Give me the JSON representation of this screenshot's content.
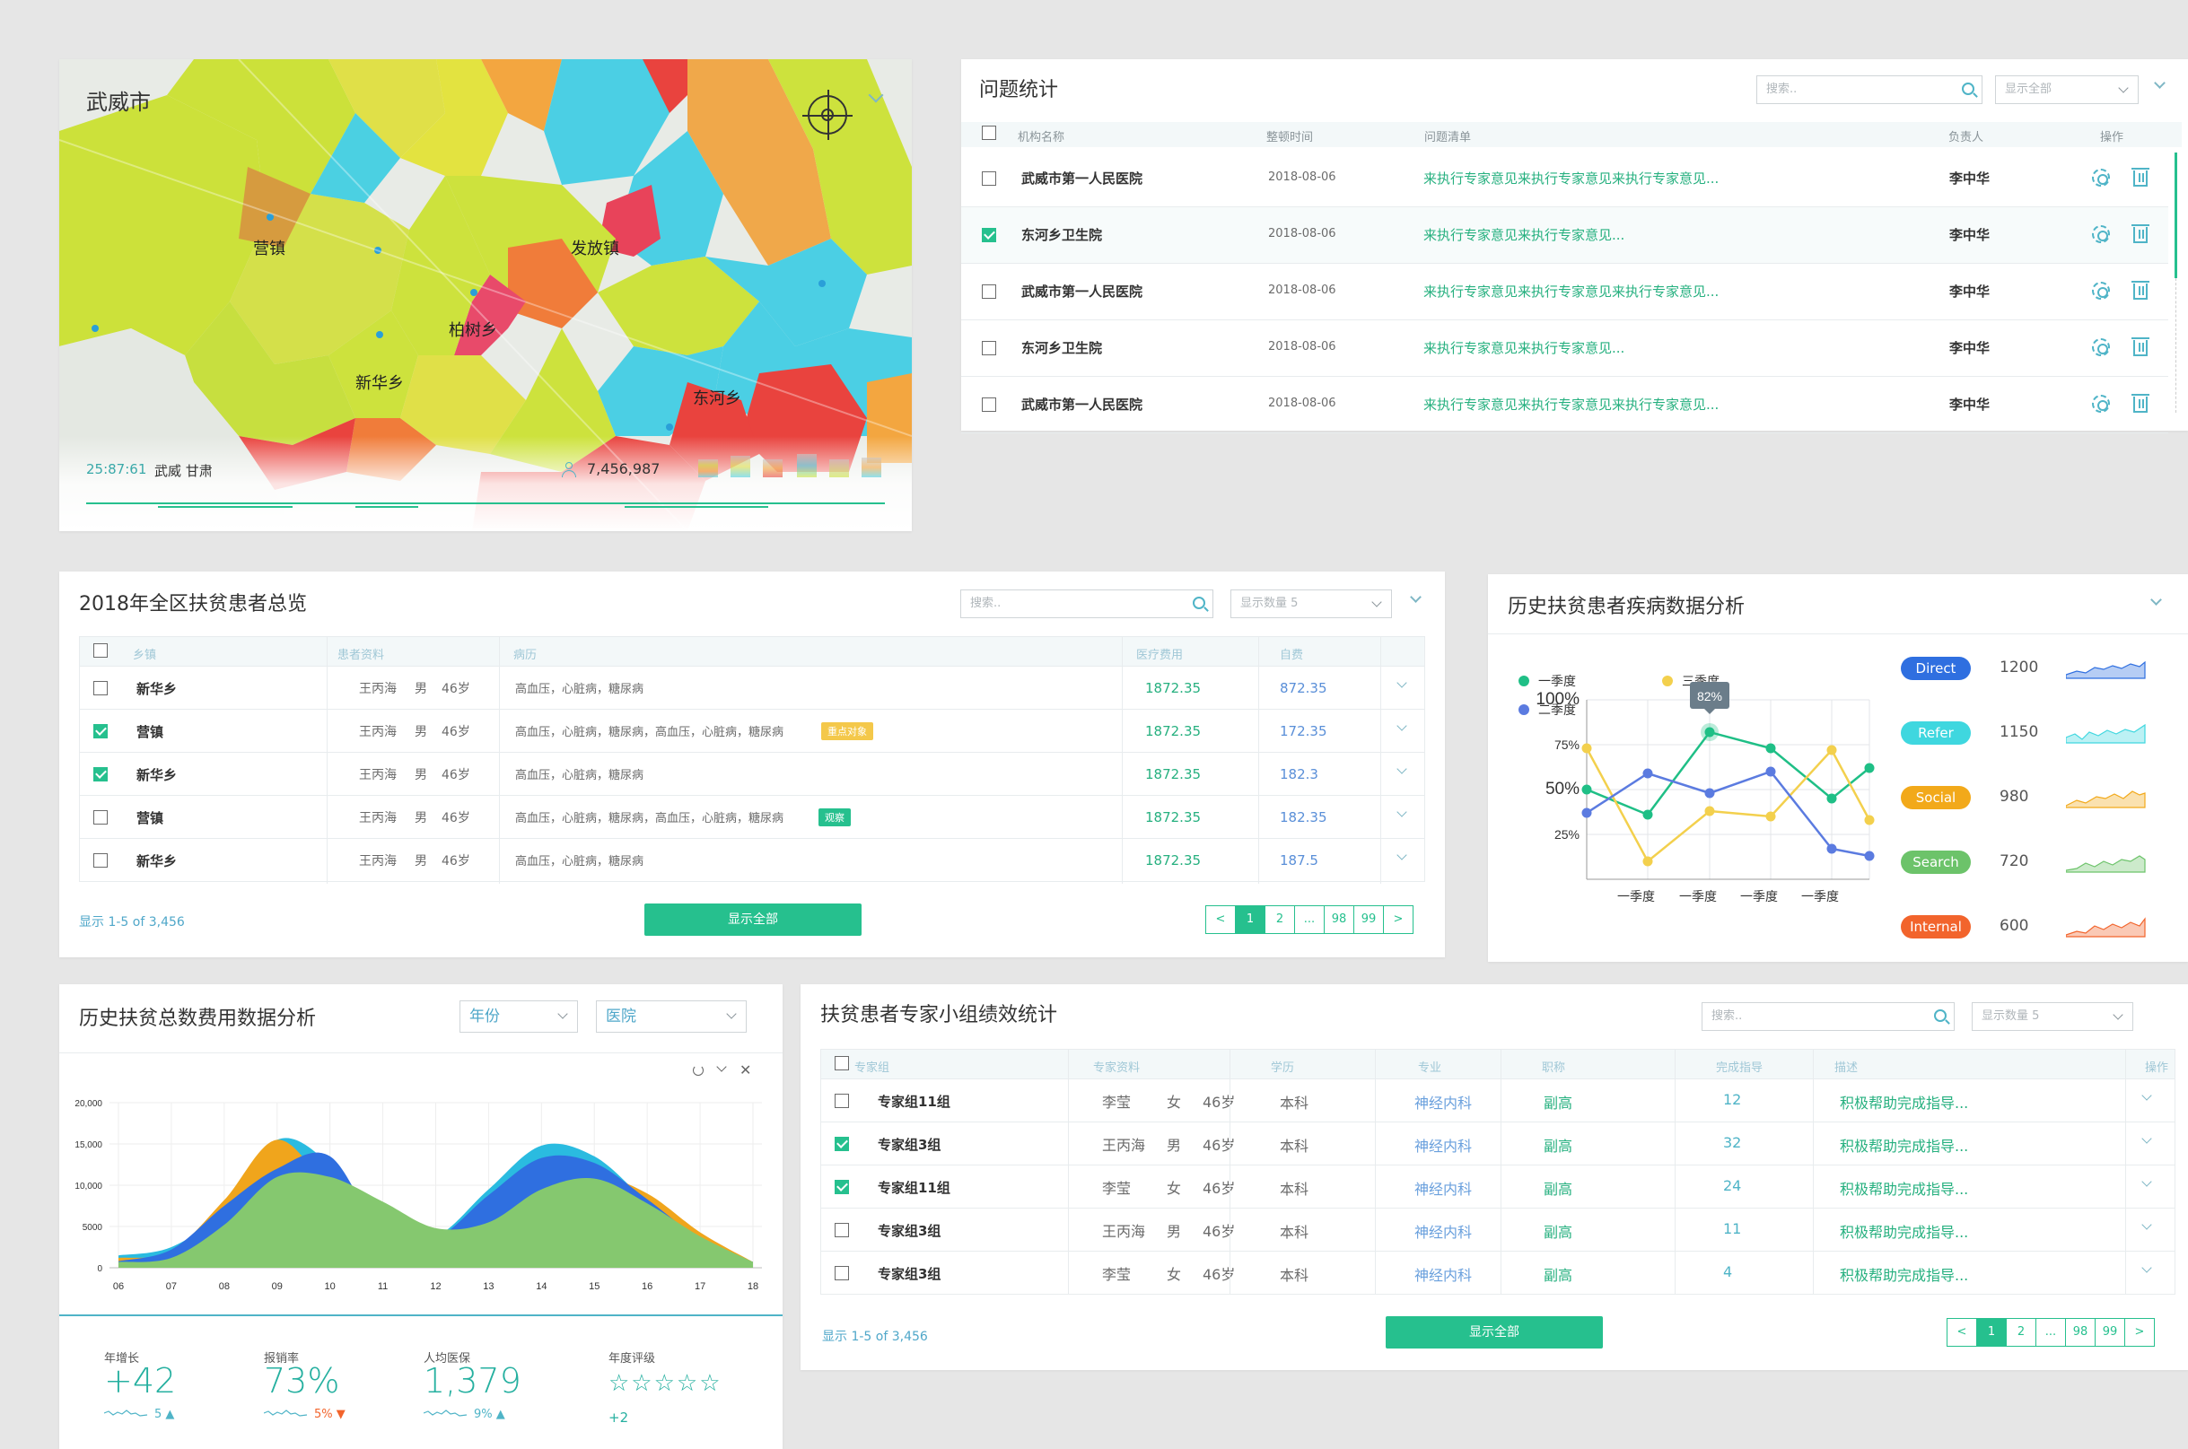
{
  "map": {
    "city": "武威市",
    "places": [
      "营镇",
      "发放镇",
      "柏树乡",
      "新华乡",
      "东河乡"
    ],
    "time": "25:87:61",
    "location": "武威 甘肃",
    "population": "7,456,987"
  },
  "issues": {
    "title": "问题统计",
    "search_placeholder": "搜索..",
    "filter": "显示全部",
    "headers": [
      "机构名称",
      "整顿时间",
      "问题清单",
      "负责人",
      "操作"
    ],
    "rows": [
      {
        "org": "武威市第一人民医院",
        "date": "2018-08-06",
        "issue": "来执行专家意见来执行专家意见来执行专家意见...",
        "owner": "李中华",
        "checked": false
      },
      {
        "org": "东河乡卫生院",
        "date": "2018-08-06",
        "issue": "来执行专家意见来执行专家意见...",
        "owner": "李中华",
        "checked": true
      },
      {
        "org": "武威市第一人民医院",
        "date": "2018-08-06",
        "issue": "来执行专家意见来执行专家意见来执行专家意见...",
        "owner": "李中华",
        "checked": false
      },
      {
        "org": "东河乡卫生院",
        "date": "2018-08-06",
        "issue": "来执行专家意见来执行专家意见...",
        "owner": "李中华",
        "checked": false
      },
      {
        "org": "武威市第一人民医院",
        "date": "2018-08-06",
        "issue": "来执行专家意见来执行专家意见来执行专家意见...",
        "owner": "李中华",
        "checked": false
      }
    ]
  },
  "patients": {
    "title": "2018年全区扶贫患者总览",
    "search_placeholder": "搜索..",
    "filter": "显示数量 5",
    "headers": [
      "乡镇",
      "患者资料",
      "病历",
      "医疗费用",
      "自费"
    ],
    "rows": [
      {
        "town": "新华乡",
        "name": "王丙海",
        "sex": "男",
        "age": "46岁",
        "history": "高血压，心脏病，糖尿病",
        "cost": "1872.35",
        "self": "872.35",
        "tag": "",
        "checked": false
      },
      {
        "town": "营镇",
        "name": "王丙海",
        "sex": "男",
        "age": "46岁",
        "history": "高血压，心脏病，糖尿病，高血压，心脏病，糖尿病",
        "cost": "1872.35",
        "self": "172.35",
        "tag": "重点对象",
        "checked": true
      },
      {
        "town": "新华乡",
        "name": "王丙海",
        "sex": "男",
        "age": "46岁",
        "history": "高血压，心脏病，糖尿病",
        "cost": "1872.35",
        "self": "182.3",
        "tag": "",
        "checked": true
      },
      {
        "town": "营镇",
        "name": "王丙海",
        "sex": "男",
        "age": "46岁",
        "history": "高血压，心脏病，糖尿病，高血压，心脏病，糖尿病",
        "cost": "1872.35",
        "self": "182.35",
        "tag": "观察",
        "checked": false
      },
      {
        "town": "新华乡",
        "name": "王丙海",
        "sex": "男",
        "age": "46岁",
        "history": "高血压，心脏病，糖尿病",
        "cost": "1872.35",
        "self": "187.5",
        "tag": "",
        "checked": false
      }
    ],
    "footer": "显示 1-5 of 3,456",
    "show_all": "显示全部",
    "pages": [
      "<",
      "1",
      "2",
      "...",
      "98",
      "99",
      ">"
    ]
  },
  "disease": {
    "title": "历史扶贫患者疾病数据分析",
    "legend": [
      "一季度",
      "三季度",
      "二季度"
    ],
    "tooltip": "82%",
    "sources": [
      {
        "name": "Direct",
        "value": "1200",
        "color": "#2f6fe0"
      },
      {
        "name": "Refer",
        "value": "1150",
        "color": "#3fd7df"
      },
      {
        "name": "Social",
        "value": "980",
        "color": "#f2a91a"
      },
      {
        "name": "Search",
        "value": "720",
        "color": "#6cc36a"
      },
      {
        "name": "Internal",
        "value": "600",
        "color": "#f2642c"
      }
    ]
  },
  "cost": {
    "title": "历史扶贫总数费用数据分析",
    "filter_year": "年份",
    "filter_hosp": "医院",
    "stats": [
      {
        "label": "年增长",
        "value": "+42",
        "sub": "5 ▲",
        "sub_color": "#4fb4c7"
      },
      {
        "label": "报销率",
        "value": "73%",
        "sub": "5% ▼",
        "sub_color": "#f2642c"
      },
      {
        "label": "人均医保",
        "value": "1,379",
        "sub": "9% ▲",
        "sub_color": "#4fb4c7"
      },
      {
        "label": "年度评级",
        "value": "☆☆☆☆☆",
        "sub": "+2",
        "sub_color": "#26b0a0"
      }
    ]
  },
  "experts": {
    "title": "扶贫患者专家小组绩效统计",
    "search_placeholder": "搜索..",
    "filter": "显示数量 5",
    "headers": [
      "专家组",
      "专家资料",
      "学历",
      "专业",
      "职称",
      "完成指导",
      "描述",
      "操作"
    ],
    "rows": [
      {
        "group": "专家组11组",
        "name": "李莹",
        "sex": "女",
        "age": "46岁",
        "edu": "本科",
        "major": "神经内科",
        "title": "副高",
        "done": "12",
        "desc": "积极帮助完成指导...",
        "checked": false
      },
      {
        "group": "专家组3组",
        "name": "王丙海",
        "sex": "男",
        "age": "46岁",
        "edu": "本科",
        "major": "神经内科",
        "title": "副高",
        "done": "32",
        "desc": "积极帮助完成指导...",
        "checked": true
      },
      {
        "group": "专家组11组",
        "name": "李莹",
        "sex": "女",
        "age": "46岁",
        "edu": "本科",
        "major": "神经内科",
        "title": "副高",
        "done": "24",
        "desc": "积极帮助完成指导...",
        "checked": true
      },
      {
        "group": "专家组3组",
        "name": "王丙海",
        "sex": "男",
        "age": "46岁",
        "edu": "本科",
        "major": "神经内科",
        "title": "副高",
        "done": "11",
        "desc": "积极帮助完成指导...",
        "checked": false
      },
      {
        "group": "专家组3组",
        "name": "李莹",
        "sex": "女",
        "age": "46岁",
        "edu": "本科",
        "major": "神经内科",
        "title": "副高",
        "done": "4",
        "desc": "积极帮助完成指导...",
        "checked": false
      }
    ],
    "footer": "显示 1-5 of 3,456",
    "show_all": "显示全部",
    "pages": [
      "<",
      "1",
      "2",
      "...",
      "98",
      "99",
      ">"
    ]
  },
  "chart_data": [
    {
      "type": "line",
      "title": "",
      "categories": [
        "一季度",
        "一季度",
        "一季度",
        "一季度",
        "",
        ""
      ],
      "x": [
        0,
        1,
        2,
        3,
        4,
        4.6,
        5
      ],
      "ylim": [
        0,
        100
      ],
      "yticks": [
        "100%",
        "75%",
        "50%",
        "25%"
      ],
      "series": [
        {
          "name": "一季度",
          "color": "#1fbf86",
          "values": [
            50,
            36,
            82,
            73,
            45,
            62
          ]
        },
        {
          "name": "三季度",
          "color": "#f3d04d",
          "values": [
            73,
            10,
            38,
            35,
            72,
            33
          ]
        },
        {
          "name": "二季度",
          "color": "#5b7be0",
          "values": [
            37,
            59,
            48,
            60,
            17,
            13
          ]
        }
      ]
    },
    {
      "type": "area",
      "title": "",
      "categories": [
        "06",
        "07",
        "08",
        "09",
        "10",
        "11",
        "12",
        "13",
        "14",
        "15",
        "16",
        "17",
        "18"
      ],
      "ylim": [
        0,
        20000
      ],
      "yticks": [
        "20,000",
        "15,000",
        "10,000",
        "5000",
        "0"
      ],
      "series": [
        {
          "name": "",
          "color": "#2abbe0",
          "values": [
            1500,
            2500,
            7000,
            15500,
            12500,
            4500,
            3800,
            9500,
            14800,
            13500,
            8000,
            3200,
            700
          ]
        },
        {
          "name": "",
          "color": "#f0a51c",
          "values": [
            1200,
            2000,
            8200,
            15500,
            9500,
            3800,
            3800,
            7000,
            9300,
            11200,
            9000,
            4300,
            700
          ]
        },
        {
          "name": "",
          "color": "#2f6fe0",
          "values": [
            800,
            2200,
            7500,
            12000,
            13500,
            4200,
            3600,
            8800,
            13300,
            12700,
            8300,
            3500,
            700
          ]
        },
        {
          "name": "",
          "color": "#85c86f",
          "values": [
            700,
            1200,
            5200,
            11000,
            11000,
            8000,
            4800,
            5500,
            9500,
            10800,
            7800,
            3800,
            700
          ]
        }
      ]
    }
  ]
}
